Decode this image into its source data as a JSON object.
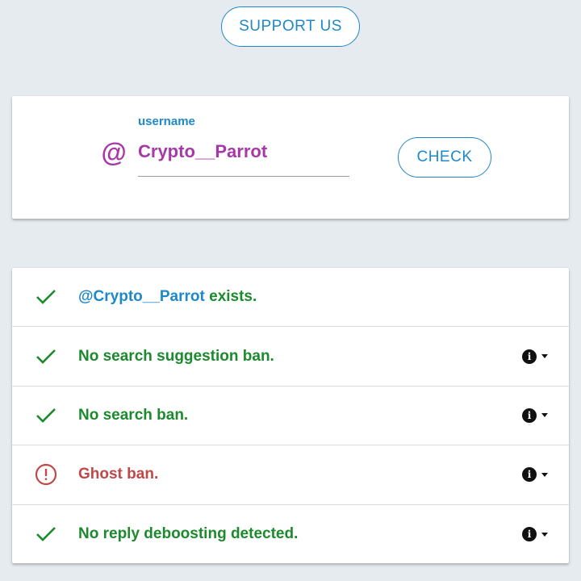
{
  "header": {
    "support_label": "SUPPORT US"
  },
  "search": {
    "at_symbol": "@",
    "label": "username",
    "value": "Crypto__Parrot",
    "check_label": "CHECK"
  },
  "results": [
    {
      "status": "ok",
      "handle": "@Crypto__Parrot",
      "text": " exists.",
      "has_info": false
    },
    {
      "status": "ok",
      "text": "No search suggestion ban.",
      "has_info": true
    },
    {
      "status": "ok",
      "text": "No search ban.",
      "has_info": true
    },
    {
      "status": "bad",
      "text": "Ghost ban.",
      "has_info": true
    },
    {
      "status": "ok",
      "text": "No reply deboosting detected.",
      "has_info": true
    }
  ],
  "colors": {
    "accent": "#1e88c8",
    "ok": "#1b8a2c",
    "bad": "#c04848",
    "username": "#a838a8"
  },
  "icons": {
    "ok": "check-icon",
    "bad": "alert-circle-icon",
    "info": "info-icon",
    "caret": "caret-down-icon"
  }
}
